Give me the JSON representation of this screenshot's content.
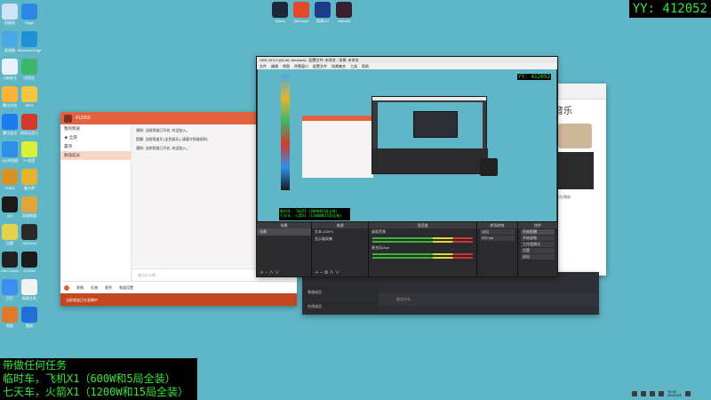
{
  "desktop_icons": [
    {
      "label": "回收站",
      "color": "#cfe3f7",
      "icon": "recycle-bin-icon"
    },
    {
      "label": "Edge",
      "color": "#2f87e5",
      "icon": "edge-icon"
    },
    {
      "label": "此电脑",
      "color": "#4aa8e6",
      "icon": "computer-icon"
    },
    {
      "label": "Microsoft Edge",
      "color": "#1e90d5",
      "icon": "edge-icon"
    },
    {
      "label": "火绒安全",
      "color": "#e8f1ff",
      "icon": "shield-icon"
    },
    {
      "label": "应用宝",
      "color": "#3fb66a",
      "icon": "store-icon"
    },
    {
      "label": "腾讯文档",
      "color": "#ffb233",
      "icon": "docs-icon"
    },
    {
      "label": "WPS",
      "color": "#f4c542",
      "icon": "wps-icon"
    },
    {
      "label": "腾讯会议",
      "color": "#1c7bf0",
      "icon": "meeting-icon"
    },
    {
      "label": "网易云音乐",
      "color": "#d33a2c",
      "icon": "music-icon"
    },
    {
      "label": "QQ浏览器",
      "color": "#2e91e8",
      "icon": "browser-icon"
    },
    {
      "label": "YY语音",
      "color": "#d8f23a",
      "icon": "yy-icon"
    },
    {
      "label": "PUBG",
      "color": "#d89322",
      "icon": "game-icon"
    },
    {
      "label": "鲁大师",
      "color": "#e8b32b",
      "icon": "tool-icon"
    },
    {
      "label": "QQ",
      "color": "#1a1a1a",
      "icon": "qq-icon"
    },
    {
      "label": "英雄联盟",
      "color": "#e3a43a",
      "icon": "game-icon"
    },
    {
      "label": "迅雷",
      "color": "#e6d24a",
      "icon": "download-icon"
    },
    {
      "label": "GeForce",
      "color": "#2a2a2a",
      "icon": "nvidia-icon"
    },
    {
      "label": "OBS Studio",
      "color": "#222222",
      "icon": "obs-icon"
    },
    {
      "label": "NVIDIA",
      "color": "#1a1a1a",
      "icon": "nvidia-icon"
    },
    {
      "label": "钉钉",
      "color": "#3b8ff0",
      "icon": "chat-icon"
    },
    {
      "label": "新建文本",
      "color": "#f2f2f2",
      "icon": "file-icon"
    },
    {
      "label": "帮助",
      "color": "#e07a28",
      "icon": "help-icon"
    },
    {
      "label": "酷狗",
      "color": "#1f6fd6",
      "icon": "music-icon"
    }
  ],
  "top_icons": [
    {
      "label": "Steam",
      "color": "#1b2838"
    },
    {
      "label": "WeGame",
      "color": "#e04a2a"
    },
    {
      "label": "网易UU",
      "color": "#1f3a8a"
    },
    {
      "label": "Valorant",
      "color": "#3a1f2c"
    }
  ],
  "yy_id": "YY: 412052",
  "overlay_lines": [
    "带做任何任务",
    "临时车，飞机X1（600W和5局全装）",
    "七天车，火箭X1（1200W和15局全装）"
  ],
  "qq_window": {
    "header": "412052",
    "side_items": [
      "我的频道",
      "★ 全部",
      "置顶",
      "频道成员"
    ],
    "selected_item": "频道成员",
    "messages": [
      "通知: 当前频道已开启, 欢迎加入。",
      "提醒: 当前频道为 [全民娱乐], 请遵守频道规则。",
      "通知: 当前频道已开启, 欢迎加入。"
    ],
    "input_placeholder": "说点什么吧...",
    "bar_items": [
      "表情",
      "礼物",
      "麦序",
      "频道设置"
    ],
    "footer": "当前频道正在直播中"
  },
  "music_window": {
    "title": "音乐",
    "subtitle": "正在播放"
  },
  "dark_window": {
    "rows": [
      "频道成员",
      "在线成员"
    ],
    "input": "说点什么..."
  },
  "obs": {
    "title": "OBS 29.0.0 (64-bit, windows) - 配置文件: 未命名 - 场景: 未命名",
    "menu": [
      "文件",
      "编辑",
      "视图",
      "停靠窗口",
      "配置文件",
      "场景集合",
      "工具",
      "帮助"
    ],
    "panels": {
      "scenes": "场景",
      "sources": "来源",
      "mixer": "混音器",
      "transitions": "转场特效",
      "controls": "控件"
    },
    "scene_item": "场景",
    "sources": [
      "文本 (GDI+)",
      "显示器采集"
    ],
    "mixer_tracks": [
      "桌面音频",
      "麦克风/Aux"
    ],
    "transition_value": "淡出",
    "duration": "300 ms",
    "controls": [
      "开始直播",
      "开始录制",
      "工作室模式",
      "设置",
      "退出"
    ],
    "overlay_text": "YY: 412052",
    "nested_overlay": "临时车, 飞机X1 (600W和5局全装)\n七天车, 火箭X1 (1200W和15局全装)"
  },
  "tray": {
    "time": "15:40",
    "date": "2023/1/8"
  }
}
